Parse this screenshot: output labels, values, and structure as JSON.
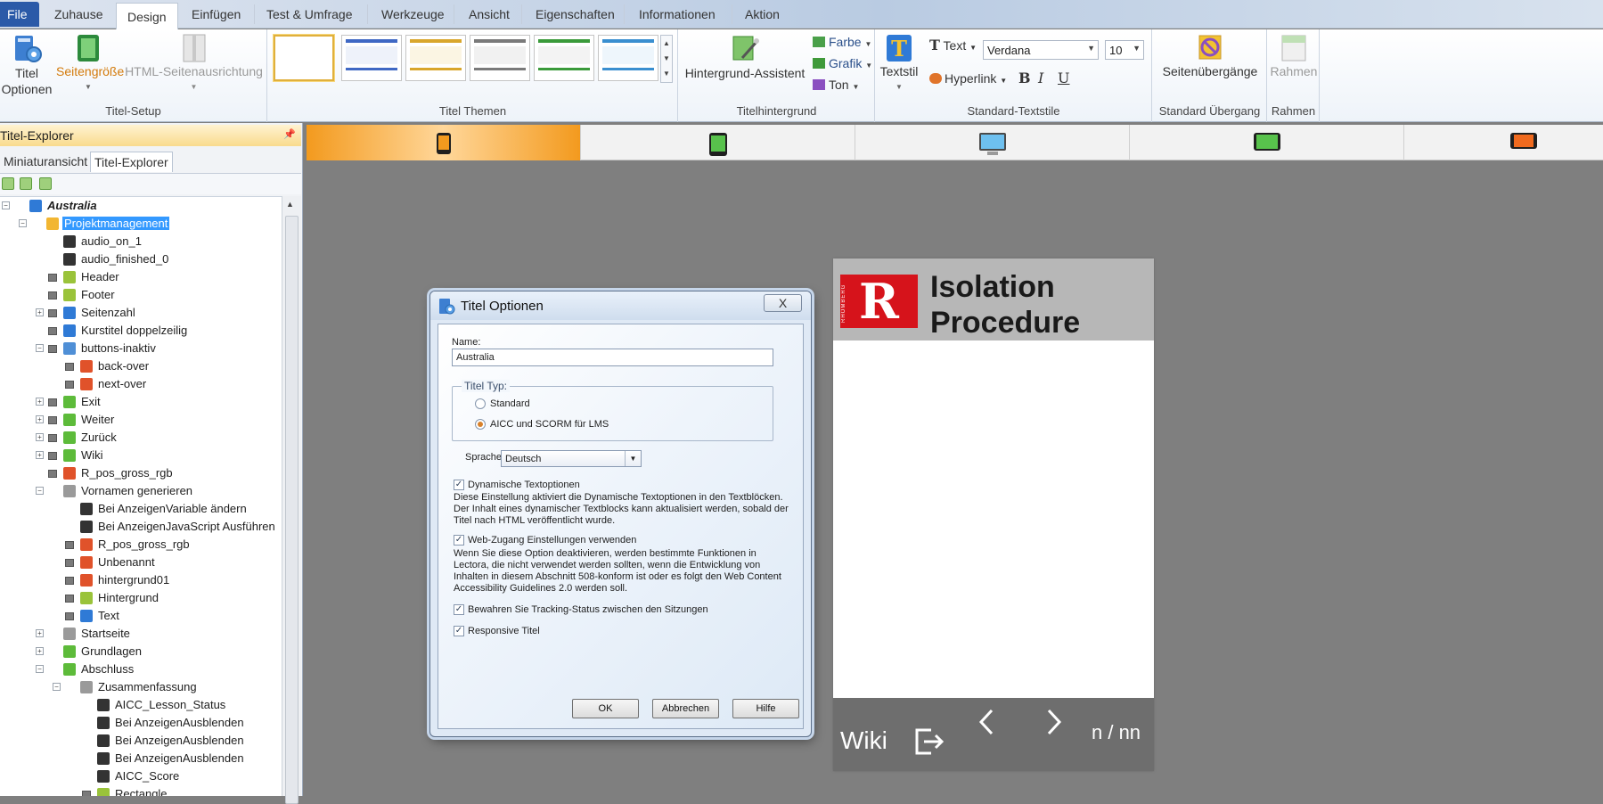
{
  "menu": {
    "file": "File",
    "tabs": [
      "Zuhause",
      "Design",
      "Einfügen",
      "Test & Umfrage",
      "Werkzeuge",
      "Ansicht",
      "Eigenschaften",
      "Informationen",
      "Aktion"
    ],
    "active": "Design"
  },
  "ribbon": {
    "titel_setup": {
      "label": "Titel-Setup",
      "titel_optionen_1": "Titel",
      "titel_optionen_2": "Optionen",
      "seitengroesse": "Seitengröße",
      "html_ausrichtung": "HTML-Seitenausrichtung"
    },
    "themen": {
      "label": "Titel Themen"
    },
    "hintergrund": {
      "label": "Titelhintergrund",
      "assistent": "Hintergrund-Assistent",
      "farbe": "Farbe",
      "grafik": "Grafik",
      "ton": "Ton"
    },
    "textstile": {
      "label": "Standard-Textstile",
      "textstil": "Textstil",
      "text": "Text",
      "font": "Verdana",
      "size": "10",
      "hyperlink": "Hyperlink",
      "bold": "B",
      "italic": "I",
      "underline": "U"
    },
    "uebergang": {
      "label": "Standard Übergang",
      "seitenuebergaenge": "Seitenübergänge"
    },
    "rahmen": {
      "label": "Rahmen",
      "rahmen_btn": "Rahmen"
    }
  },
  "pane": {
    "header": "Titel-Explorer",
    "tabs": [
      "Miniaturansicht",
      "Titel-Explorer"
    ],
    "tree": [
      {
        "label": "Australia",
        "icon": "book-icon",
        "color": "#2f7ad6"
      },
      {
        "label": "Projektmanagement",
        "icon": "folder-icon",
        "color": "#f2b632"
      },
      {
        "label": "audio_on_1",
        "icon": "action-icon",
        "color": "#333333"
      },
      {
        "label": "audio_finished_0",
        "icon": "action-icon",
        "color": "#333333"
      },
      {
        "label": "Header",
        "icon": "group-icon",
        "color": "#9ac33a"
      },
      {
        "label": "Footer",
        "icon": "group-icon",
        "color": "#9ac33a"
      },
      {
        "label": "Seitenzahl",
        "icon": "text-icon",
        "color": "#2f7ad6"
      },
      {
        "label": "Kurstitel doppelzeilig",
        "icon": "text-icon",
        "color": "#2f7ad6"
      },
      {
        "label": "buttons-inaktiv",
        "icon": "group-icon",
        "color": "#4f8fd6"
      },
      {
        "label": "back-over",
        "icon": "image-icon",
        "color": "#e0522a"
      },
      {
        "label": "next-over",
        "icon": "image-icon",
        "color": "#e0522a"
      },
      {
        "label": "Exit",
        "icon": "button-icon",
        "color": "#5dbb3a"
      },
      {
        "label": "Weiter",
        "icon": "button-icon",
        "color": "#5dbb3a"
      },
      {
        "label": "Zurück",
        "icon": "button-icon",
        "color": "#5dbb3a"
      },
      {
        "label": "Wiki",
        "icon": "button-icon",
        "color": "#5dbb3a"
      },
      {
        "label": "R_pos_gross_rgb",
        "icon": "image-icon",
        "color": "#e0522a"
      },
      {
        "label": "Vornamen generieren",
        "icon": "page-icon",
        "color": "#9a9a9a"
      },
      {
        "label": "Bei AnzeigenVariable ändern",
        "icon": "action-icon",
        "color": "#333333"
      },
      {
        "label": "Bei AnzeigenJavaScript Ausführen",
        "icon": "action-icon",
        "color": "#333333"
      },
      {
        "label": "R_pos_gross_rgb",
        "icon": "image-icon",
        "color": "#e0522a"
      },
      {
        "label": "Unbenannt",
        "icon": "image-icon",
        "color": "#e0522a"
      },
      {
        "label": "hintergrund01",
        "icon": "image-icon",
        "color": "#e0522a"
      },
      {
        "label": "Hintergrund",
        "icon": "group-icon",
        "color": "#9ac33a"
      },
      {
        "label": "Text",
        "icon": "text-icon",
        "color": "#2f7ad6"
      },
      {
        "label": "Startseite",
        "icon": "page-icon",
        "color": "#9a9a9a"
      },
      {
        "label": "Grundlagen",
        "icon": "chapter-icon",
        "color": "#5dbb3a"
      },
      {
        "label": "Abschluss",
        "icon": "chapter-icon",
        "color": "#5dbb3a"
      },
      {
        "label": "Zusammenfassung",
        "icon": "page-icon",
        "color": "#9a9a9a"
      },
      {
        "label": "AICC_Lesson_Status",
        "icon": "action-icon",
        "color": "#333333"
      },
      {
        "label": "Bei AnzeigenAusblenden",
        "icon": "action-icon",
        "color": "#333333"
      },
      {
        "label": "Bei AnzeigenAusblenden",
        "icon": "action-icon",
        "color": "#333333"
      },
      {
        "label": "Bei AnzeigenAusblenden",
        "icon": "action-icon",
        "color": "#333333"
      },
      {
        "label": "AICC_Score",
        "icon": "action-icon",
        "color": "#333333"
      },
      {
        "label": "Rectangle",
        "icon": "group-icon",
        "color": "#9ac33a"
      }
    ]
  },
  "devices": [
    "phone-portrait-icon",
    "tablet-portrait-icon",
    "desktop-icon",
    "tablet-landscape-icon",
    "phone-landscape-icon"
  ],
  "stage": {
    "title_line1": "Isolation",
    "title_line2": "Procedure",
    "logo_letter": "R",
    "logo_vertical": "RHOMBERG",
    "wiki": "Wiki",
    "page": "n / nn",
    "accent": "#d6131b"
  },
  "dialog": {
    "title": "Titel Optionen",
    "name_label": "Name:",
    "name_value": "Australia",
    "typ_label": "Titel Typ:",
    "typ_standard": "Standard",
    "typ_aicc": "AICC und SCORM für LMS",
    "sprache_label": "Sprache:",
    "sprache_value": "Deutsch",
    "dyn_label": "Dynamische Textoptionen",
    "dyn_desc": "Diese Einstellung aktiviert die Dynamische Textoptionen in den Textblöcken. Der Inhalt eines dynamischer Textblocks kann aktualisiert werden, sobald der Titel nach HTML veröffentlicht wurde.",
    "web_label": "Web-Zugang Einstellungen verwenden",
    "web_desc": "Wenn Sie diese Option deaktivieren, werden bestimmte Funktionen in Lectora, die nicht verwendet werden sollten, wenn die Entwicklung von Inhalten in diesem Abschnitt 508-konform ist oder es folgt den Web Content Accessibility Guidelines 2.0 werden soll.",
    "track_label": "Bewahren Sie Tracking-Status zwischen den Sitzungen",
    "resp_label": "Responsive Titel",
    "ok": "OK",
    "cancel": "Abbrechen",
    "help": "Hilfe",
    "close": "X"
  }
}
